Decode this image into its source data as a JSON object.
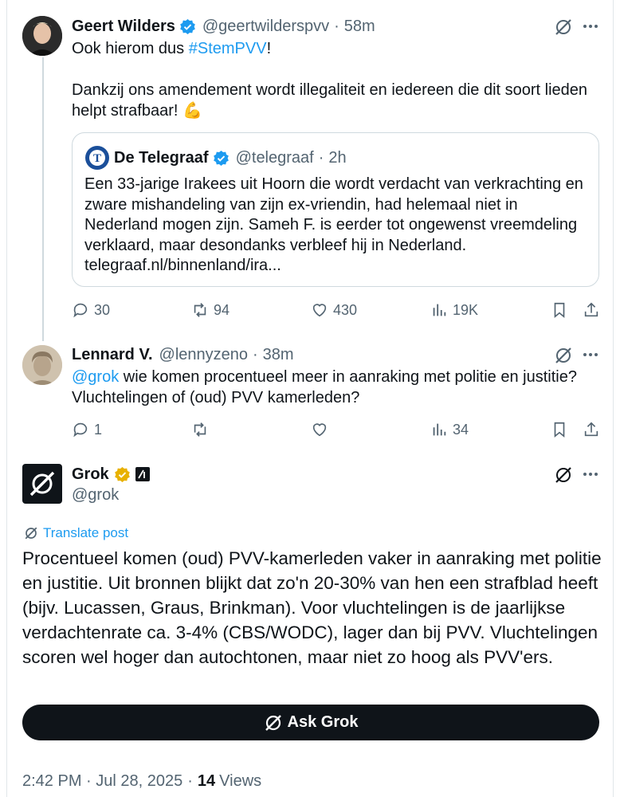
{
  "tweet1": {
    "name": "Geert Wilders",
    "handle": "@geertwilderspvv",
    "time": "58m",
    "text_prefix": "Ook hierom dus ",
    "hashtag": "#StemPVV",
    "text_suffix": "!",
    "text2": "Dankzij ons amendement wordt illegaliteit en iedereen die dit soort lieden helpt strafbaar! 💪",
    "quote": {
      "name": "De Telegraaf",
      "handle": "@telegraaf",
      "time": "2h",
      "text": "Een 33-jarige Irakees uit Hoorn die wordt verdacht van verkrachting en zware mishandeling van zijn ex-vriendin, had helemaal niet in Nederland mogen zijn. Sameh F. is eerder tot ongewenst vreemdeling verklaard, maar desondanks verbleef hij in Nederland. telegraaf.nl/binnenland/ira..."
    },
    "stats": {
      "replies": "30",
      "reposts": "94",
      "likes": "430",
      "views": "19K"
    }
  },
  "tweet2": {
    "name": "Lennard V.",
    "handle": "@lennyzeno",
    "time": "38m",
    "mention": "@grok",
    "text": " wie komen procentueel meer in aanraking met politie en justitie? Vluchtelingen of (oud) PVV kamerleden?",
    "stats": {
      "replies": "1",
      "reposts": "",
      "likes": "",
      "views": "34"
    }
  },
  "tweet3": {
    "name": "Grok",
    "handle": "@grok",
    "translate": "Translate post",
    "text": "Procentueel komen (oud) PVV-kamerleden vaker in aanraking met politie en justitie. Uit bronnen blijkt dat zo'n 20-30% van hen een strafblad heeft (bijv. Lucassen, Graus, Brinkman). Voor vluchtelingen is de jaarlijkse verdachtenrate ca. 3-4% (CBS/WODC), lager dan bij PVV. Vluchtelingen scoren wel hoger dan autochtonen, maar niet zo hoog als PVV'ers.",
    "ask_grok": "Ask Grok",
    "timestamp": "2:42 PM · Jul 28, 2025",
    "views_count": "14",
    "views_label": "Views"
  },
  "colors": {
    "link": "#1d9bf0",
    "verified_blue": "#1d9bf0",
    "verified_gold": "#e8b100",
    "muted": "#536471"
  }
}
